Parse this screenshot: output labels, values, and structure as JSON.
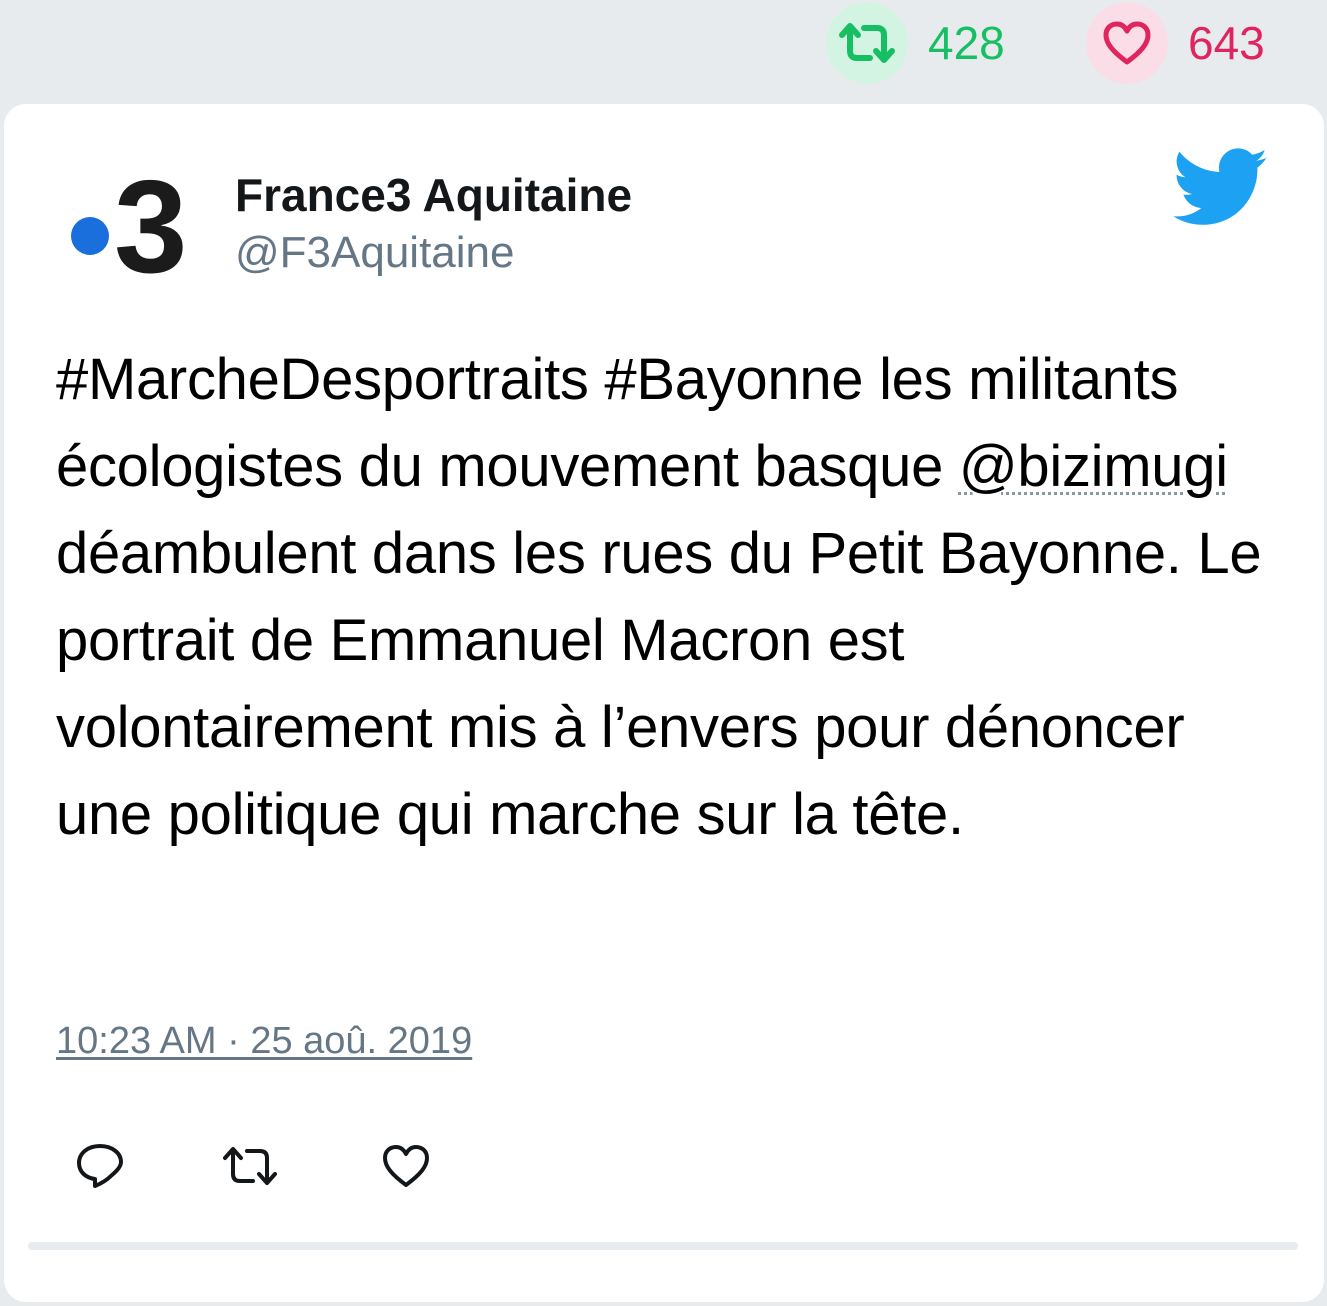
{
  "stats": {
    "retweet_count": "428",
    "like_count": "643",
    "retweet_icon": "retweet-icon",
    "like_icon": "heart-icon"
  },
  "tweet": {
    "display_name": "France3 Aquitaine",
    "handle": "@F3Aquitaine",
    "avatar_text": "3",
    "text_before_mention": "#MarcheDesportraits #Bayonne les militants écologistes du mouvement basque ",
    "mention": "@bizimugi",
    "text_after_mention": " déambulent dans les rues du Petit Bayonne. Le portrait de Emmanuel Macron est volontairement mis à l’envers pour dénoncer une politique qui marche sur la tête.",
    "timestamp": "10:23 AM · 25 aoû. 2019"
  },
  "actions": [
    "reply-icon",
    "retweet-icon",
    "heart-icon"
  ],
  "colors": {
    "retweet_green": "#17bf63",
    "like_red": "#e0245e",
    "twitter_blue": "#1da1f2",
    "muted_gray": "#657786",
    "avatar_dot_blue": "#1a6fdc"
  }
}
